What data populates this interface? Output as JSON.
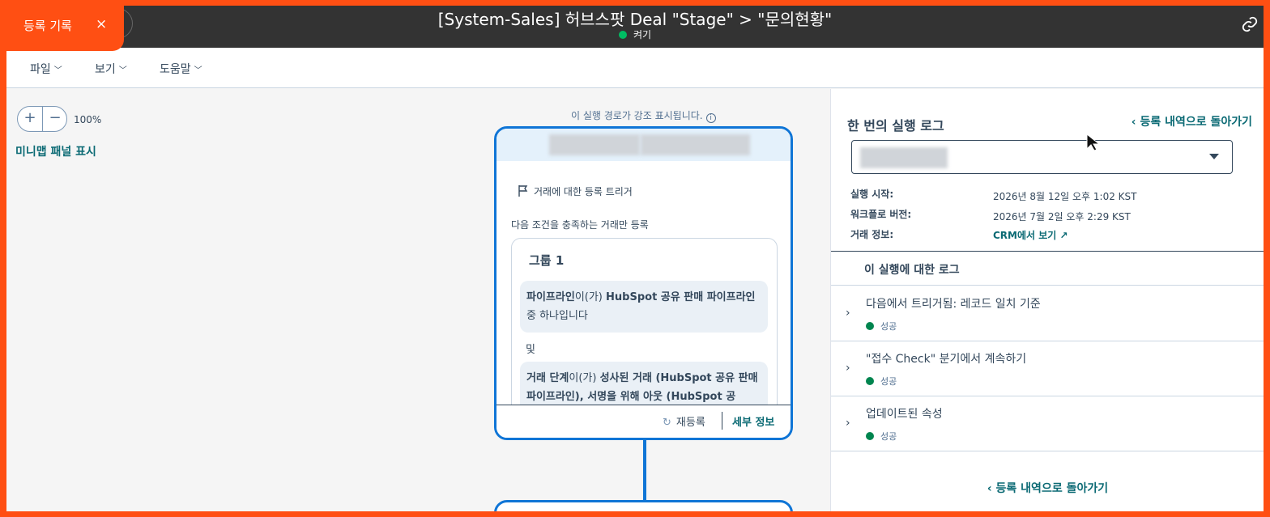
{
  "enroll_tag": {
    "label": "등록 기록",
    "close": "×"
  },
  "header": {
    "title": "[System-Sales] 허브스팟 Deal \"Stage\" > \"문의현황\"",
    "status": "켜기",
    "status_color": "#00bd63"
  },
  "menu": {
    "items": [
      "파일",
      "보기",
      "도움말"
    ]
  },
  "canvas": {
    "zoom_in": "+",
    "zoom_out": "−",
    "zoom_level": "100%",
    "minimap_toggle": "미니맵 패널 표시",
    "path_note": "이 실행 경로가 강조 표시됩니다.",
    "path_note_icon": "i"
  },
  "card": {
    "trigger": "거래에 대한 등록 트리거",
    "condition_desc": "다음 조건을 충족하는 거래만 등록",
    "group_title": "그룹 1",
    "filter1": {
      "prop": "파이프라인",
      "op": "이(가)",
      "value": "HubSpot 공유 판매 파이프라인",
      "suffix": " 중 하나입니다"
    },
    "and_label": "및",
    "filter2": {
      "prop": "거래 단계",
      "op": "이(가)",
      "value": "성사된 거래 (HubSpot 공유 판매 파이프라인), 서명을 위해 아웃 (HubSpot 공"
    },
    "reenroll": "재등록",
    "reenroll_icon": "↻",
    "details": "세부 정보"
  },
  "panel": {
    "title": "한 번의 실행 로그",
    "back_top": "등록 내역으로 돌아가기",
    "meta": [
      {
        "label": "실행 시작:",
        "value": "2026년 8월 12일 오후 1:02 KST"
      },
      {
        "label": "워크플로 버전:",
        "value": "2026년 7월 2일 오후 2:29 KST"
      },
      {
        "label": "거래 정보:",
        "value": ""
      }
    ],
    "crm_link": "CRM에서 보기",
    "crm_link_icon": "↗",
    "log_header": "이 실행에 대한 로그",
    "logs": [
      {
        "title": "다음에서 트리거됨: 레코드 일치 기준",
        "status": "성공"
      },
      {
        "title": "\"접수 Check\" 분기에서 계속하기",
        "status": "성공"
      },
      {
        "title": "업데이트된 속성",
        "status": "성공"
      }
    ],
    "success_color": "#00854f",
    "back_bottom": "등록 내역으로 돌아가기"
  },
  "icons": {
    "link": "link-icon",
    "flag": "flag-icon",
    "chevron": "chevron-right-icon",
    "caret": "caret-down-icon"
  },
  "colors": {
    "accent": "#ff4f13",
    "primary_link": "#0b6a74",
    "card_border": "#0f75d6",
    "topbar": "#333333"
  }
}
